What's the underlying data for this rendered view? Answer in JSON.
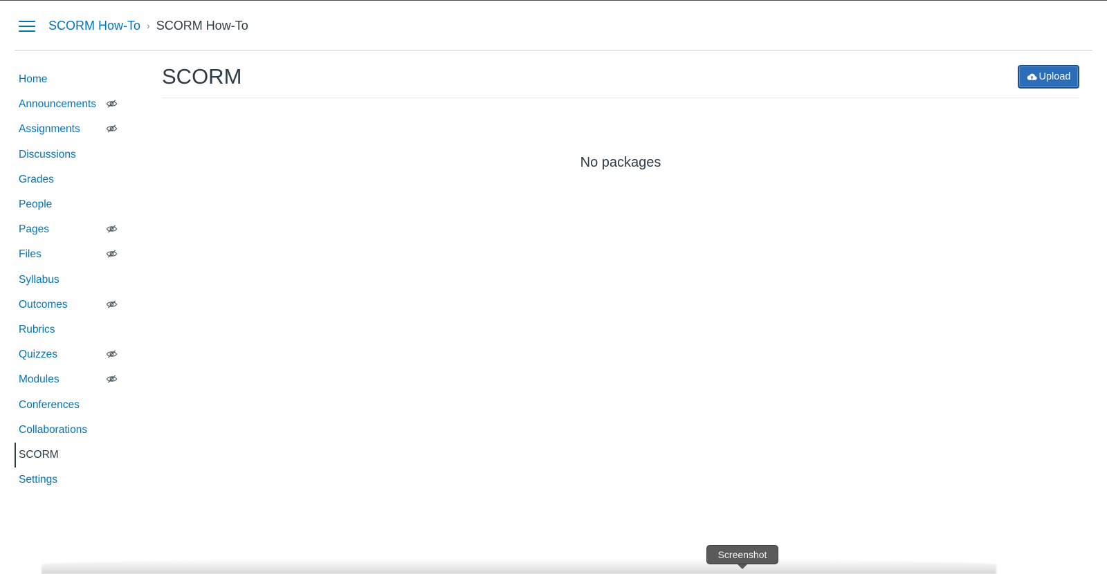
{
  "header": {
    "breadcrumb_link": "SCORM How-To",
    "breadcrumb_separator": "›",
    "breadcrumb_current": "SCORM How-To"
  },
  "sidebar": {
    "items": [
      {
        "label": "Home",
        "hidden_icon": false,
        "active": false
      },
      {
        "label": "Announcements",
        "hidden_icon": true,
        "active": false
      },
      {
        "label": "Assignments",
        "hidden_icon": true,
        "active": false
      },
      {
        "label": "Discussions",
        "hidden_icon": false,
        "active": false
      },
      {
        "label": "Grades",
        "hidden_icon": false,
        "active": false
      },
      {
        "label": "People",
        "hidden_icon": false,
        "active": false
      },
      {
        "label": "Pages",
        "hidden_icon": true,
        "active": false
      },
      {
        "label": "Files",
        "hidden_icon": true,
        "active": false
      },
      {
        "label": "Syllabus",
        "hidden_icon": false,
        "active": false
      },
      {
        "label": "Outcomes",
        "hidden_icon": true,
        "active": false
      },
      {
        "label": "Rubrics",
        "hidden_icon": false,
        "active": false
      },
      {
        "label": "Quizzes",
        "hidden_icon": true,
        "active": false
      },
      {
        "label": "Modules",
        "hidden_icon": true,
        "active": false
      },
      {
        "label": "Conferences",
        "hidden_icon": false,
        "active": false
      },
      {
        "label": "Collaborations",
        "hidden_icon": false,
        "active": false
      },
      {
        "label": "SCORM",
        "hidden_icon": false,
        "active": true
      },
      {
        "label": "Settings",
        "hidden_icon": false,
        "active": false
      }
    ]
  },
  "main": {
    "title": "SCORM",
    "upload_label": "Upload",
    "empty_message": "No packages"
  },
  "tooltip": {
    "label": "Screenshot"
  },
  "colors": {
    "link": "#0374b5",
    "text": "#2d3b45",
    "button": "#2b6db7"
  },
  "icons": {
    "menu": "hamburger-menu-icon",
    "hidden": "eye-slash-icon",
    "upload": "cloud-upload-icon"
  }
}
